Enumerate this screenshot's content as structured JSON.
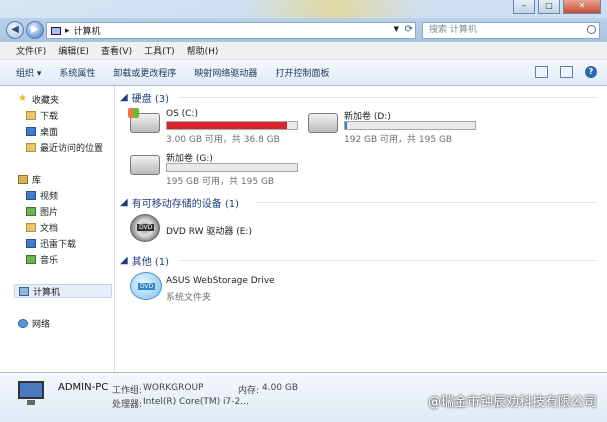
{
  "address": {
    "breadcrumb": "计算机",
    "separator": "▸"
  },
  "search": {
    "placeholder": "搜索 计算机"
  },
  "menu": [
    "文件(F)",
    "编辑(E)",
    "查看(V)",
    "工具(T)",
    "帮助(H)"
  ],
  "toolbar": [
    "组织 ▾",
    "系统属性",
    "卸载或更改程序",
    "映射网络驱动器",
    "打开控制面板"
  ],
  "nav": {
    "favorites": "收藏夹",
    "favorites_items": [
      "下载",
      "桌面",
      "最近访问的位置"
    ],
    "libraries": "库",
    "library_items": [
      "视频",
      "图片",
      "文档",
      "迅雷下载",
      "音乐"
    ],
    "computer": "计算机",
    "network": "网络"
  },
  "groups": {
    "hard_disks": "硬盘 (3)",
    "removable": "有可移动存储的设备 (1)",
    "other": "其他 (1)"
  },
  "drives": [
    {
      "name": "OS (C:)",
      "free": "3.00 GB 可用，共 36.8 GB",
      "used_fraction": 0.92,
      "color": "#d8242c"
    },
    {
      "name": "新加卷 (D:)",
      "free": "192 GB 可用，共 195 GB",
      "used_fraction": 0.015,
      "color": "#2a86d8"
    },
    {
      "name": "新加卷 (G:)",
      "free": "195 GB 可用，共 195 GB",
      "used_fraction": 0.0,
      "color": "#2a86d8"
    }
  ],
  "dvd": {
    "name": "DVD RW 驱动器 (E:)",
    "badge": "DVD"
  },
  "other_item": {
    "name": "ASUS WebStorage Drive",
    "sub": "系统文件夹",
    "badge": "DVD"
  },
  "details": {
    "pc_name": "ADMIN-PC",
    "workgroup_label": "工作组:",
    "workgroup": "WORKGROUP",
    "memory_label": "内存:",
    "memory": "4.00 GB",
    "cpu_label": "处理器:",
    "cpu": "Intel(R) Core(TM) i7-2..."
  },
  "watermark": "@瑞金市钟辰劝科技有限公司"
}
